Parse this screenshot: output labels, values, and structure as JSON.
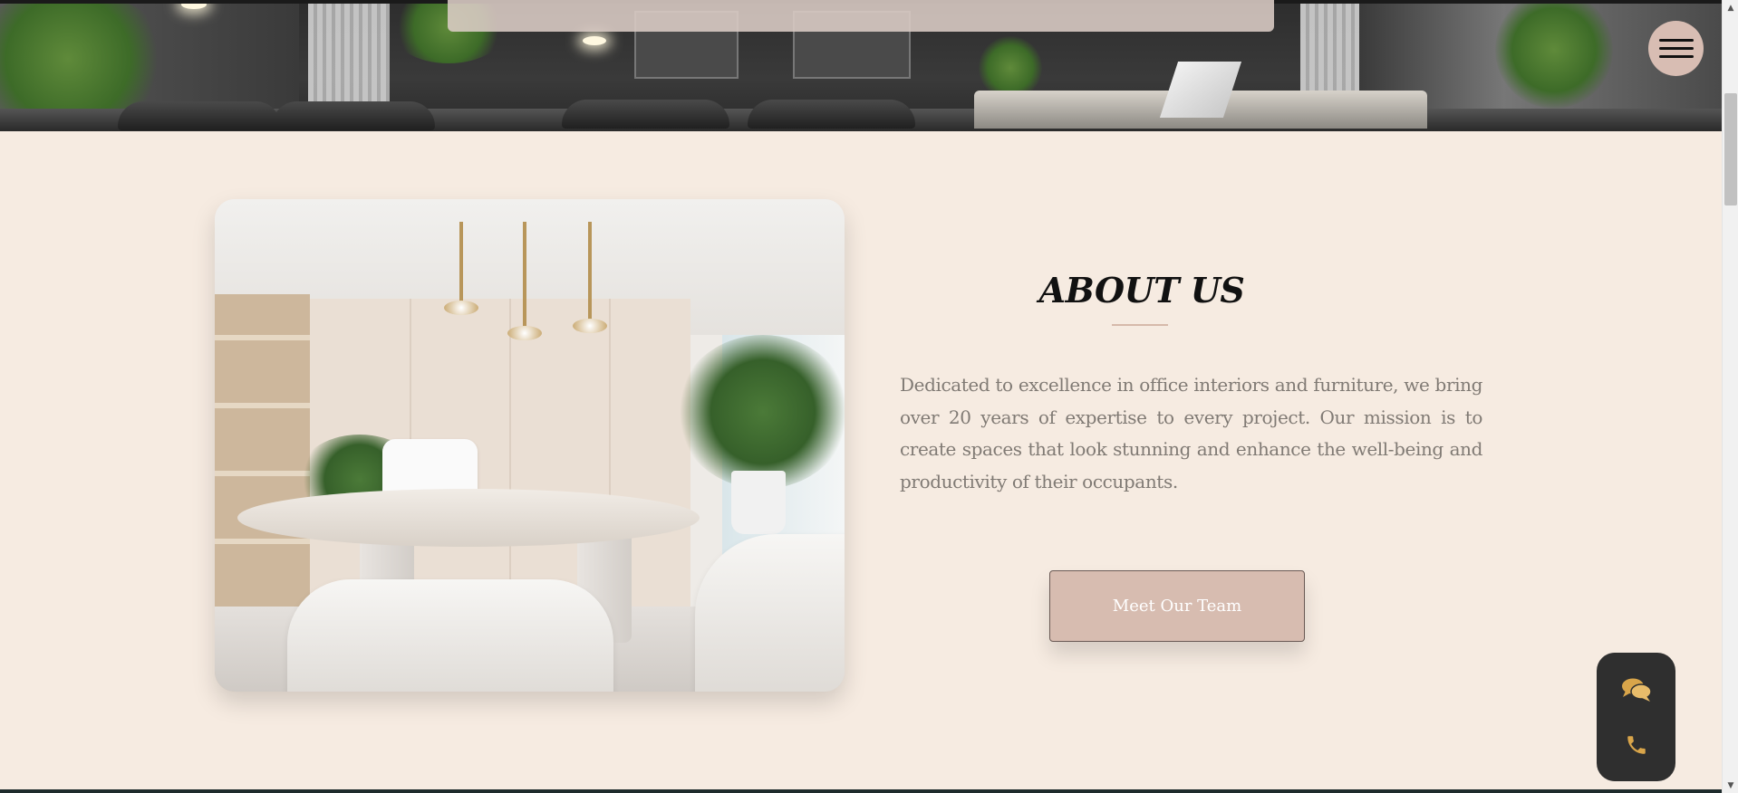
{
  "header": {
    "menu_icon": "hamburger-icon"
  },
  "about": {
    "title": "ABOUT US",
    "body": "Dedicated to excellence in office interiors and furniture, we bring over 20 years of expertise to every project. Our mission is to create spaces that look stunning and enhance the well-being and productivity of their occupants.",
    "button_label": "Meet Our Team"
  },
  "contact_widget": {
    "icons": [
      "chat-icon",
      "phone-icon"
    ]
  },
  "colors": {
    "background": "#f6ebe1",
    "accent": "#d7bcb0",
    "body_text": "#807a74",
    "widget": "#2f2f2f",
    "icon_gold": "#d9a54a"
  }
}
